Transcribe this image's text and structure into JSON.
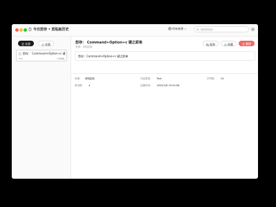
{
  "window": {
    "title": "今日剪存 • 剪贴板历史",
    "filter_label": "所有来源",
    "search_placeholder": "搜索剪贴板..."
  },
  "sidebar": {
    "tabs": [
      {
        "label": "全部",
        "active": true
      },
      {
        "label": "收藏",
        "active": false
      }
    ],
    "items": [
      {
        "text": "剪存： Command+Option+c 键之...",
        "type": "Text",
        "time": "1分钟前"
      }
    ]
  },
  "main": {
    "title": "剪存： Command+Option+c 键之即来",
    "subtitle": "来源：未知应用",
    "buttons": {
      "copy": "复制",
      "favorite": "收藏",
      "delete": "删除"
    },
    "content": "剪存：Command+Option+c 键之即来",
    "info": [
      {
        "label": "来源：",
        "value": "未知应用"
      },
      {
        "label": "内容类型：",
        "value": "Text"
      },
      {
        "label": "字符数：",
        "value": "24"
      },
      {
        "label": "单词数：",
        "value": "4"
      },
      {
        "label": "创建时间：",
        "value": "2025/1/6 19:20:58"
      }
    ]
  },
  "colors": {
    "accent": "#1b1b1b",
    "delete": "#f06a6a"
  }
}
